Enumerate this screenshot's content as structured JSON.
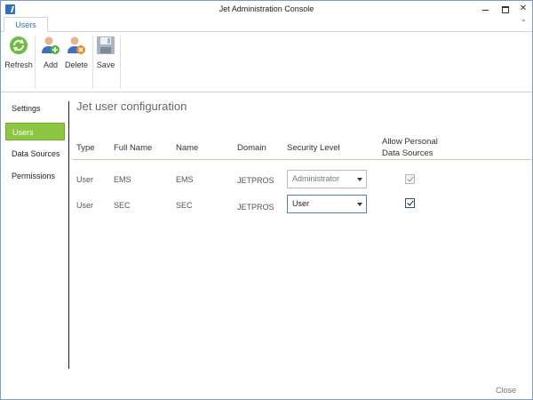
{
  "window": {
    "title": "Jet Administration Console"
  },
  "tabs": [
    {
      "label": "Users"
    }
  ],
  "ribbon": {
    "refresh_label": "Refresh",
    "add_label": "Add",
    "delete_label": "Delete",
    "save_label": "Save"
  },
  "nav": {
    "items": [
      {
        "label": "Settings",
        "active": false
      },
      {
        "label": "Users",
        "active": true
      },
      {
        "label": "Data Sources",
        "active": false
      },
      {
        "label": "Permissions",
        "active": false
      }
    ]
  },
  "main": {
    "title": "Jet user configuration",
    "columns": {
      "type": "Type",
      "full_name": "Full Name",
      "name": "Name",
      "domain": "Domain",
      "security_level": "Security Level",
      "allow_personal_line1": "Allow Personal",
      "allow_personal_line2": "Data Sources"
    },
    "rows": [
      {
        "type": "User",
        "full_name": "EMS",
        "name": "EMS",
        "domain": "JETPROS",
        "security_level": "Administrator",
        "allow_personal": true,
        "enabled": false
      },
      {
        "type": "User",
        "full_name": "SEC",
        "name": "SEC",
        "domain": "JETPROS",
        "security_level": "User",
        "allow_personal": true,
        "enabled": true
      }
    ]
  },
  "footer": {
    "close_label": "Close"
  },
  "colors": {
    "accent": "#8dc641",
    "header_line": "#b9d88a",
    "tab_text": "#2f6fbf"
  }
}
